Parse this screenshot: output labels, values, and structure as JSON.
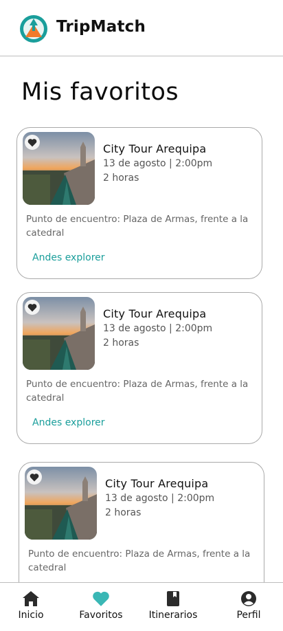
{
  "app": {
    "name": "TripMatch"
  },
  "page": {
    "title": "Mis favoritos"
  },
  "colors": {
    "accent": "#1a9e9b",
    "heart_active": "#3ab7b5",
    "logo_orange": "#f07a2b"
  },
  "favorites": [
    {
      "title": "City Tour Arequipa",
      "date": "13 de agosto | 2:00pm",
      "duration": "2 horas",
      "meeting_point": "Punto de encuentro: Plaza de Armas, frente a la catedral",
      "agency": "Andes explorer",
      "icon": "heart-icon"
    },
    {
      "title": "City Tour Arequipa",
      "date": "13 de agosto | 2:00pm",
      "duration": "2 horas",
      "meeting_point": "Punto de encuentro: Plaza de Armas, frente a la catedral",
      "agency": "Andes explorer",
      "icon": "heart-icon"
    },
    {
      "title": "City Tour Arequipa",
      "date": "13 de agosto | 2:00pm",
      "duration": "2 horas",
      "meeting_point": "Punto de encuentro: Plaza de Armas, frente a la catedral",
      "agency": "",
      "icon": "heart-icon"
    }
  ],
  "nav": {
    "items": [
      {
        "label": "Inicio",
        "icon": "home-icon"
      },
      {
        "label": "Favoritos",
        "icon": "heart-icon",
        "active": true
      },
      {
        "label": "Itinerarios",
        "icon": "book-icon"
      },
      {
        "label": "Perfil",
        "icon": "user-icon"
      }
    ]
  }
}
